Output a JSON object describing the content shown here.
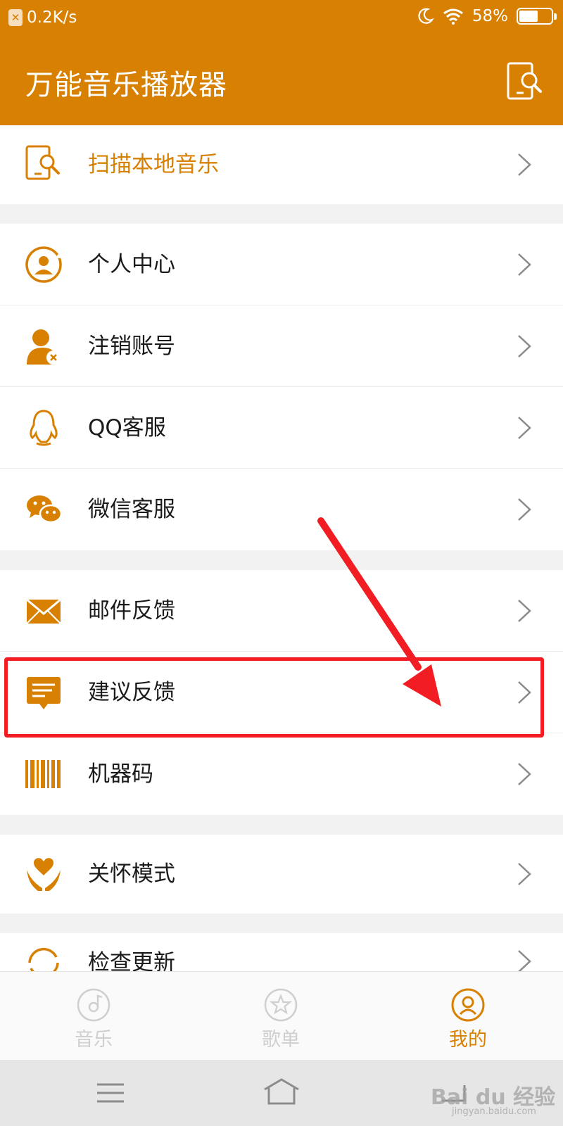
{
  "status_bar": {
    "net_speed": "0.2K/s",
    "battery_percent": "58%",
    "battery_level": 0.58
  },
  "header": {
    "title": "万能音乐播放器",
    "scan_icon": "phone-scan-icon"
  },
  "menu": {
    "scan_local": {
      "label": "扫描本地音乐",
      "icon": "phone-scan-icon"
    },
    "personal_center": {
      "label": "个人中心",
      "icon": "user-circle-icon"
    },
    "cancel_account": {
      "label": "注销账号",
      "icon": "user-remove-icon"
    },
    "qq_service": {
      "label": "QQ客服",
      "icon": "qq-penguin-icon"
    },
    "wechat_service": {
      "label": "微信客服",
      "icon": "wechat-icon"
    },
    "email_feedback": {
      "label": "邮件反馈",
      "icon": "mail-icon"
    },
    "suggestion_feedback": {
      "label": "建议反馈",
      "icon": "message-icon"
    },
    "machine_code": {
      "label": "机器码",
      "icon": "barcode-icon"
    },
    "care_mode": {
      "label": "关怀模式",
      "icon": "heart-hands-icon"
    },
    "check_update": {
      "label": "检查更新",
      "icon": "refresh-icon"
    }
  },
  "tabs": [
    {
      "label": "音乐",
      "icon": "disc-icon",
      "active": false
    },
    {
      "label": "歌单",
      "icon": "star-circle-icon",
      "active": false
    },
    {
      "label": "我的",
      "icon": "user-circle-icon",
      "active": true
    }
  ],
  "watermark": {
    "text": "Bai du 经验",
    "sub": "jingyan.baidu.com"
  },
  "colors": {
    "accent": "#d78001",
    "highlight": "#f21d22",
    "inactive": "#cfcfcf"
  }
}
